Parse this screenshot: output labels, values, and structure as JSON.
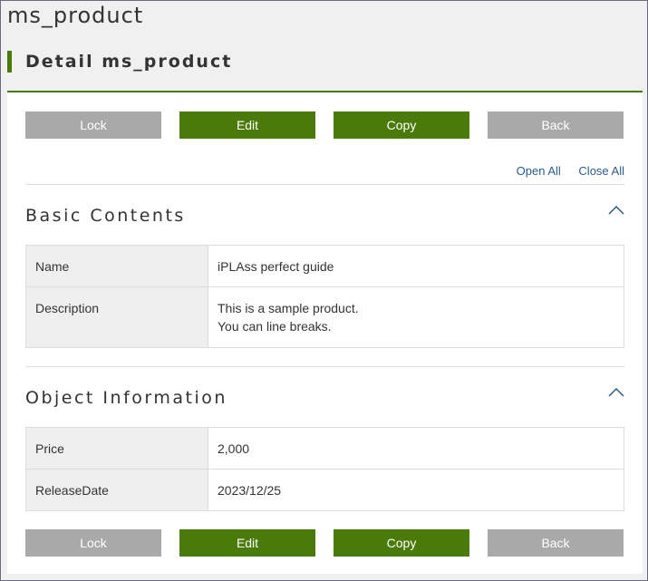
{
  "app": {
    "title": "ms_product"
  },
  "page": {
    "heading": "Detail ms_product"
  },
  "toolbar": {
    "lock_label": "Lock",
    "edit_label": "Edit",
    "copy_label": "Copy",
    "back_label": "Back"
  },
  "toggles": {
    "open_all": "Open All",
    "close_all": "Close All"
  },
  "sections": [
    {
      "title": "Basic Contents",
      "rows": [
        {
          "label": "Name",
          "value_lines": [
            "iPLAss perfect guide"
          ]
        },
        {
          "label": "Description",
          "value_lines": [
            "This is a sample product.",
            "You can line breaks."
          ]
        }
      ]
    },
    {
      "title": "Object Information",
      "rows": [
        {
          "label": "Price",
          "value_lines": [
            "2,000"
          ]
        },
        {
          "label": "ReleaseDate",
          "value_lines": [
            "2023/12/25"
          ]
        }
      ]
    }
  ],
  "icons": {
    "collapse": "chevron-up-icon"
  },
  "colors": {
    "accent": "#4a7a0a",
    "button_gray": "#a9a9a9",
    "link": "#2a5a8a"
  }
}
